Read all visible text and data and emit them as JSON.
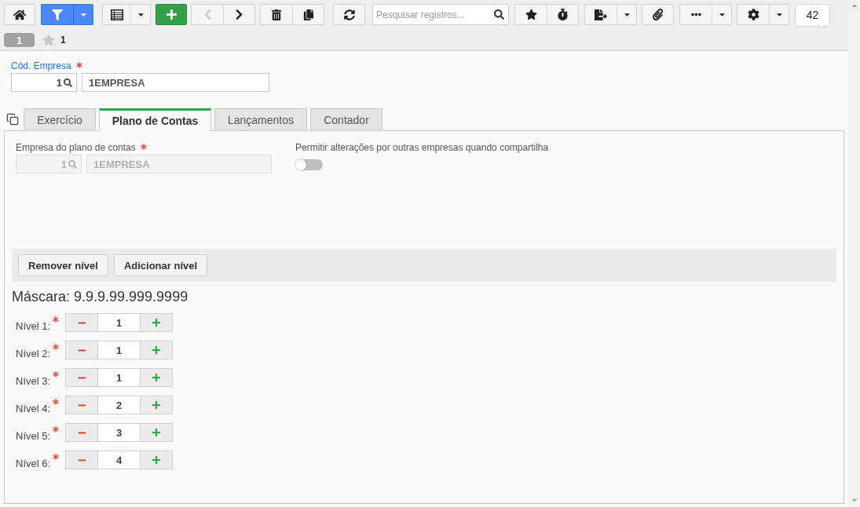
{
  "toolbar": {
    "filter_active": true,
    "previous_disabled": true,
    "search": {
      "placeholder": "Pesquisar registros..."
    },
    "record_count": "42"
  },
  "record_tab": "1",
  "favorites": {
    "starred": false,
    "count": "1"
  },
  "company_field": {
    "label": "Cód. Empresa",
    "required": true,
    "disabled": false,
    "code": "1",
    "name": "1EMPRESA"
  },
  "tabs": [
    {
      "label": "Exercício",
      "selected": false
    },
    {
      "label": "Plano de Contas",
      "selected": true
    },
    {
      "label": "Lançamentos",
      "selected": false
    },
    {
      "label": "Contador",
      "selected": false
    }
  ],
  "plan_panel": {
    "company_field": {
      "label": "Empresa do plano de contas",
      "required": true,
      "disabled": true,
      "code": "1",
      "name": "1EMPRESA"
    },
    "share_toggle": {
      "label": "Permitir alterações por outras empresas quando compartilha",
      "on": false
    },
    "buttons": [
      "Remover nível",
      "Adicionar nível"
    ],
    "mask": "Máscara: 9.9.9.99.999.9999",
    "levels": [
      {
        "label": "Nível 1:",
        "required": true,
        "value": "1"
      },
      {
        "label": "Nível 2:",
        "required": true,
        "value": "1"
      },
      {
        "label": "Nível 3:",
        "required": true,
        "value": "1"
      },
      {
        "label": "Nível 4:",
        "required": true,
        "value": "2"
      },
      {
        "label": "Nível 5:",
        "required": true,
        "value": "3"
      },
      {
        "label": "Nível 6:",
        "required": true,
        "value": "4"
      }
    ]
  }
}
